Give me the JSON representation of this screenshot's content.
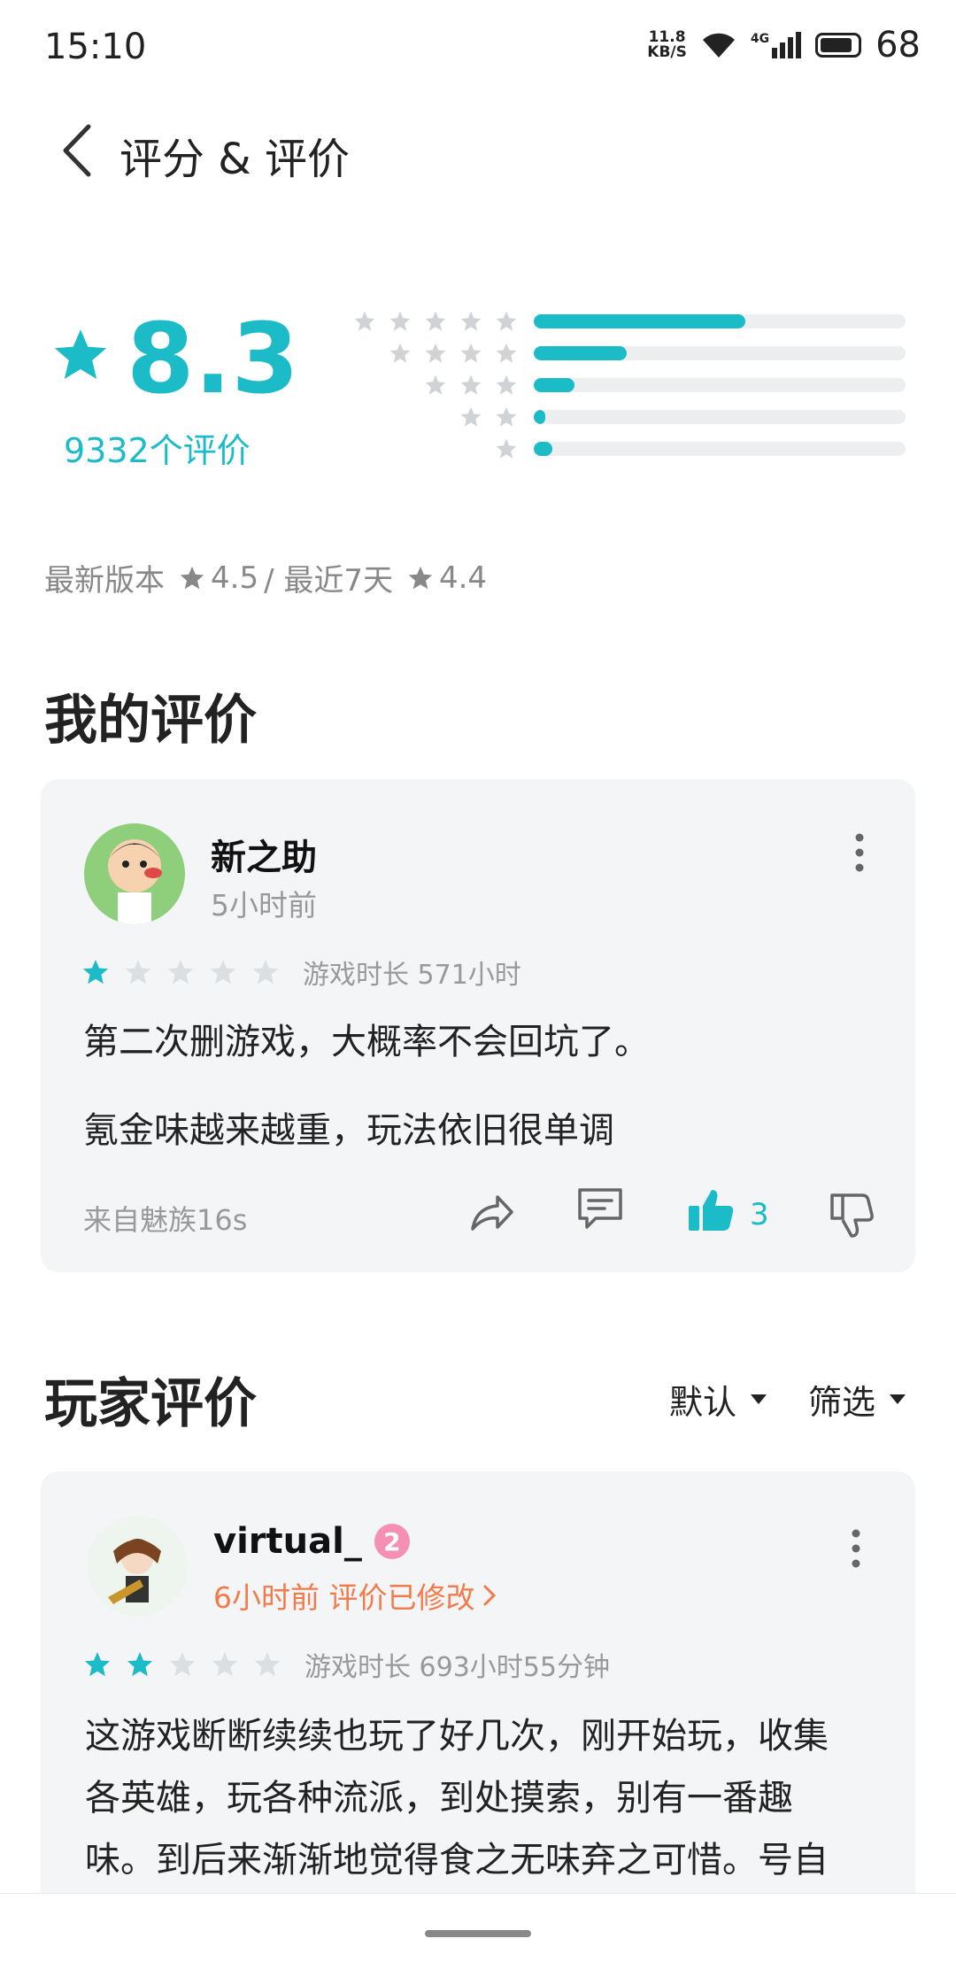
{
  "status": {
    "time": "15:10",
    "net_speed_top": "11.8",
    "net_speed_bottom": "KB/S",
    "signal_label": "4G",
    "battery": "68"
  },
  "header": {
    "title": "评分 & 评价"
  },
  "summary": {
    "score": "8.3",
    "count_text": "9332个评价",
    "distribution": [
      {
        "stars": 5,
        "fraction": 0.57
      },
      {
        "stars": 4,
        "fraction": 0.25
      },
      {
        "stars": 3,
        "fraction": 0.11
      },
      {
        "stars": 2,
        "fraction": 0.03
      },
      {
        "stars": 1,
        "fraction": 0.05
      }
    ],
    "latest_label": "最新版本",
    "latest_score": "4.5",
    "separator": "/ 最近7天",
    "recent_score": "4.4"
  },
  "my_review": {
    "heading": "我的评价",
    "user": "新之助",
    "time": "5小时前",
    "stars": 1,
    "playtime": "游戏时长 571小时",
    "lines": [
      "第二次删游戏，大概率不会回坑了。",
      "氪金味越来越重，玩法依旧很单调"
    ],
    "source": "来自魅族16s",
    "likes": "3"
  },
  "player_reviews": {
    "heading": "玩家评价",
    "sort_label": "默认",
    "filter_label": "筛选",
    "items": [
      {
        "user": "virtual_",
        "level": "2",
        "time_edited": "6小时前 评价已修改",
        "stars": 2,
        "playtime": "游戏时长 693小时55分钟",
        "lines": [
          "这游戏断断续续也玩了好几次，刚开始玩，收集",
          "各英雄，玩各种流派，到处摸索，别有一番趣",
          "味。到后来渐渐地觉得食之无味弃之可惜。号自"
        ]
      }
    ]
  },
  "colors": {
    "accent": "#1bbcc7",
    "star_empty": "#dcdfe2",
    "edited": "#f27b4b"
  }
}
